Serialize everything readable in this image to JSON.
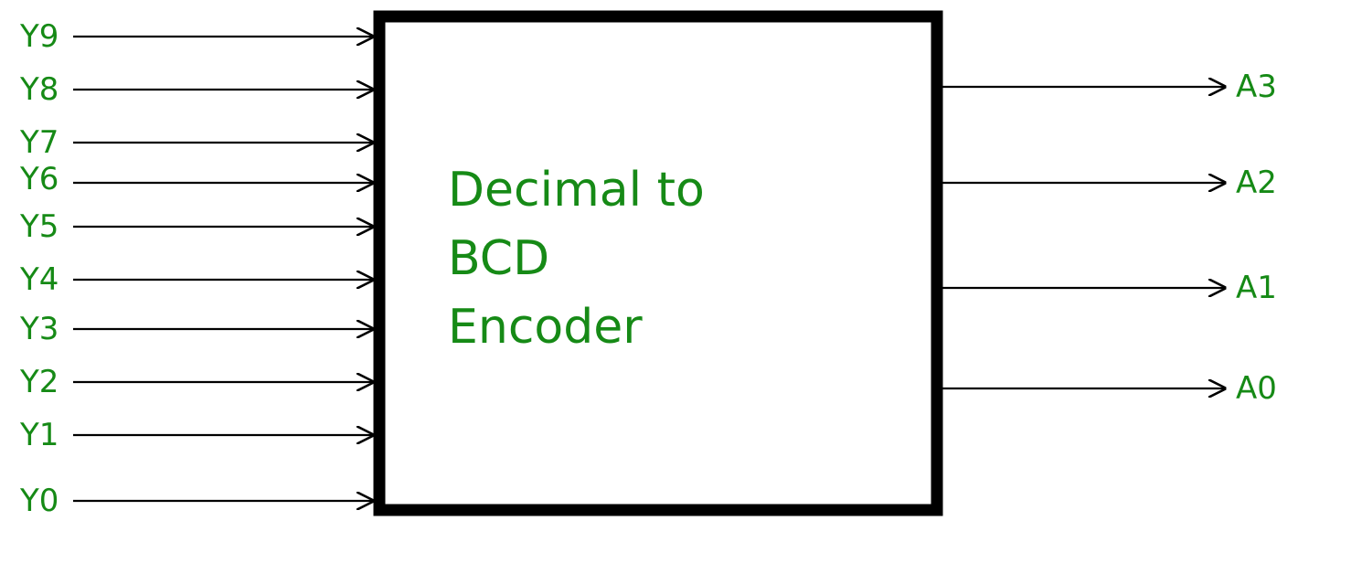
{
  "block": {
    "title_line1": "Decimal to",
    "title_line2": "BCD",
    "title_line3": "Encoder"
  },
  "inputs": [
    {
      "label": "Y9"
    },
    {
      "label": "Y8"
    },
    {
      "label": "Y7"
    },
    {
      "label": "Y6"
    },
    {
      "label": "Y5"
    },
    {
      "label": "Y4"
    },
    {
      "label": "Y3"
    },
    {
      "label": "Y2"
    },
    {
      "label": "Y1"
    },
    {
      "label": "Y0"
    }
  ],
  "outputs": [
    {
      "label": "A3"
    },
    {
      "label": "A2"
    },
    {
      "label": "A1"
    },
    {
      "label": "A0"
    }
  ],
  "colors": {
    "label": "#168a16",
    "wire": "#000000"
  }
}
